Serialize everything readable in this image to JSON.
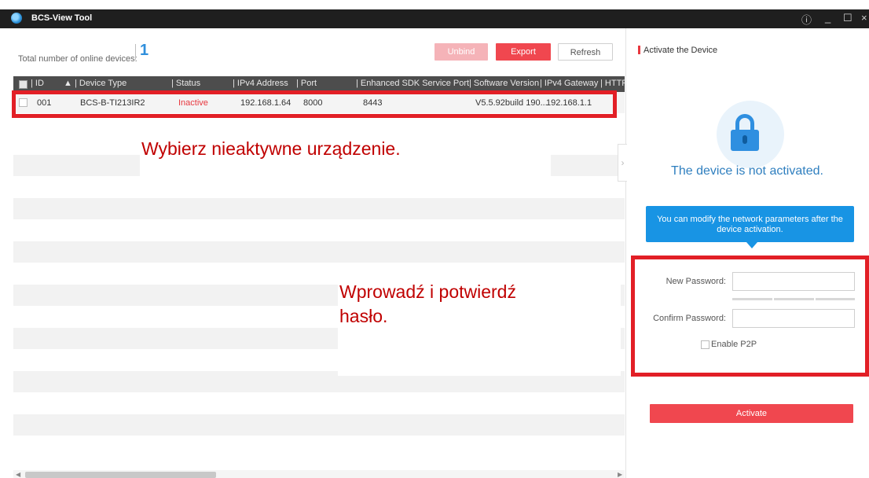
{
  "window": {
    "title": "BCS-View Tool"
  },
  "toolbar": {
    "total_label": "Total number of online devices:",
    "total_count": "1",
    "unbind_label": "Unbind",
    "export_label": "Export",
    "refresh_label": "Refresh"
  },
  "table": {
    "columns": [
      "ID",
      "Device Type",
      "Status",
      "IPv4 Address",
      "Port",
      "Enhanced SDK Service Port",
      "Software Version",
      "IPv4 Gateway",
      "HTTP"
    ],
    "rows": [
      {
        "id": "001",
        "device_type": "BCS-B-TI213IR2",
        "status": "Inactive",
        "ipv4": "192.168.1.64",
        "port": "8000",
        "sdk_port": "8443",
        "software_version": "V5.5.92build 190...",
        "gateway": "192.168.1.1"
      }
    ]
  },
  "annotations": {
    "select_device": "Wybierz nieaktywne urządzenie.",
    "enter_password_line1": "Wprowadź i potwierdź",
    "enter_password_line2": "hasło."
  },
  "panel": {
    "heading": "Activate the Device",
    "status_text": "The device is not activated.",
    "tooltip": "You can modify the network parameters after the device activation.",
    "new_password_label": "New Password:",
    "confirm_password_label": "Confirm Password:",
    "enable_p2p_label": "Enable P2P",
    "activate_label": "Activate"
  },
  "colors": {
    "accent_red": "#f0474f",
    "accent_blue": "#1894e4",
    "annotation_red": "#c00000"
  }
}
